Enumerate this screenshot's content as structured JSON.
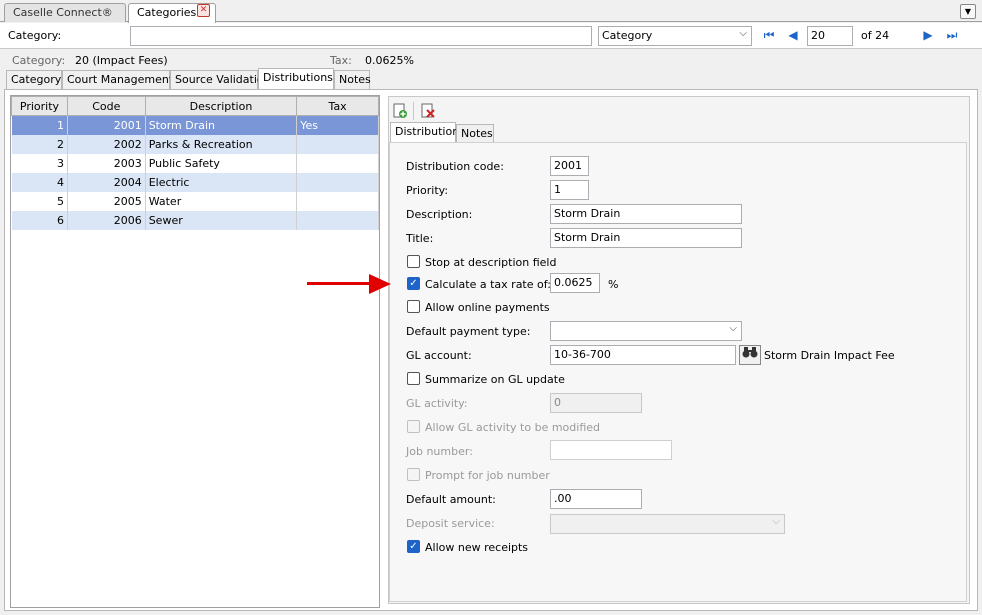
{
  "window_tabs": [
    {
      "label": "Caselle Connect®"
    },
    {
      "label": "Categories"
    }
  ],
  "category_row": {
    "label": "Category:",
    "value": "",
    "select_value": "Category",
    "page_current": "20",
    "page_of": "of 24"
  },
  "info": {
    "category_label": "Category:",
    "category_value": "20 (Impact Fees)",
    "tax_label": "Tax:",
    "tax_value": "0.0625%"
  },
  "main_tabs": [
    "Category",
    "Court Management",
    "Source Validation",
    "Distributions",
    "Notes"
  ],
  "grid": {
    "headers": [
      "Priority",
      "Code",
      "Description",
      "Tax"
    ],
    "rows": [
      {
        "priority": "1",
        "code": "2001",
        "description": "Storm Drain",
        "tax": "Yes"
      },
      {
        "priority": "2",
        "code": "2002",
        "description": "Parks & Recreation",
        "tax": ""
      },
      {
        "priority": "3",
        "code": "2003",
        "description": "Public Safety",
        "tax": ""
      },
      {
        "priority": "4",
        "code": "2004",
        "description": "Electric",
        "tax": ""
      },
      {
        "priority": "5",
        "code": "2005",
        "description": "Water",
        "tax": ""
      },
      {
        "priority": "6",
        "code": "2006",
        "description": "Sewer",
        "tax": ""
      }
    ]
  },
  "detail_tabs": [
    "Distribution",
    "Notes"
  ],
  "form": {
    "distribution_code_label": "Distribution code:",
    "distribution_code": "2001",
    "priority_label": "Priority:",
    "priority": "1",
    "description_label": "Description:",
    "description": "Storm Drain",
    "title_label": "Title:",
    "title": "Storm Drain",
    "stop_label": "Stop at description field",
    "calc_tax_label": "Calculate a tax rate of:",
    "tax_rate": "0.0625",
    "percent": "%",
    "online_label": "Allow online payments",
    "default_payment_label": "Default payment type:",
    "default_payment": "",
    "gl_account_label": "GL account:",
    "gl_account": "10-36-700",
    "gl_account_desc": "Storm Drain Impact Fee",
    "summarize_label": "Summarize on GL update",
    "gl_activity_label": "GL activity:",
    "gl_activity": "0",
    "allow_gl_label": "Allow GL activity to be modified",
    "job_number_label": "Job number:",
    "job_number": "",
    "prompt_job_label": "Prompt for job number",
    "default_amount_label": "Default amount:",
    "default_amount": ".00",
    "deposit_label": "Deposit service:",
    "deposit_value": "",
    "allow_receipts_label": "Allow new receipts"
  },
  "colors": {
    "accent": "#1e64c8",
    "selected_row": "#7a96d6",
    "alt_row": "#dae6f6",
    "arrow": "#e00000"
  }
}
